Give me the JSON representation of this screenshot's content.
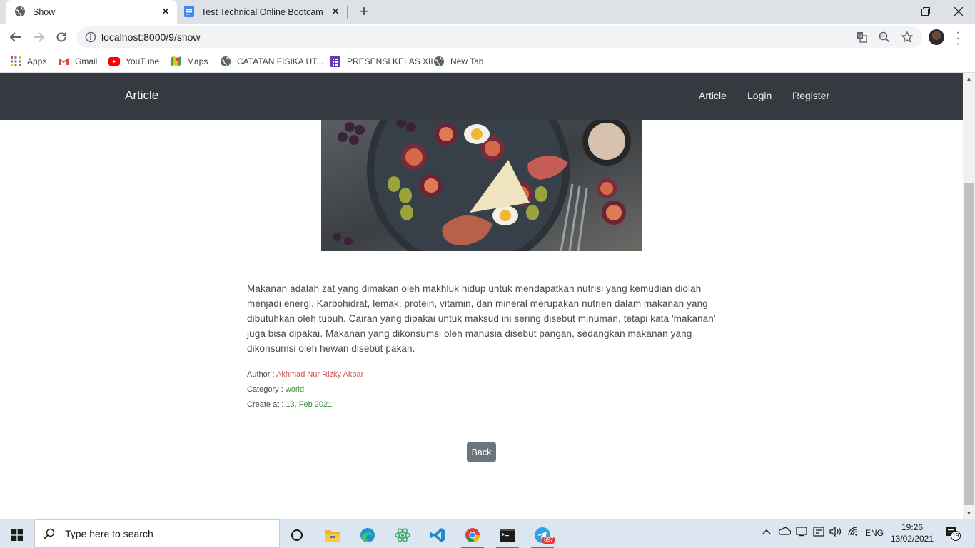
{
  "browser": {
    "tabs": [
      {
        "title": "Show",
        "active": true
      },
      {
        "title": "Test Technical Online Bootcamp D",
        "active": false
      }
    ],
    "url": "localhost:8000/9/show",
    "bookmarks": [
      "Apps",
      "Gmail",
      "YouTube",
      "Maps",
      "CATATAN FISIKA UT...",
      "PRESENSI KELAS XII",
      "New Tab"
    ]
  },
  "site": {
    "brand": "Article",
    "nav": [
      "Article",
      "Login",
      "Register"
    ]
  },
  "article": {
    "body": "Makanan adalah zat yang dimakan oleh makhluk hidup untuk mendapatkan nutrisi yang kemudian diolah menjadi energi. Karbohidrat, lemak, protein, vitamin, dan mineral merupakan nutrien dalam makanan yang dibutuhkan oleh tubuh. Cairan yang dipakai untuk maksud ini sering disebut minuman, tetapi kata 'makanan' juga bisa dipakai. Makanan yang dikonsumsi oleh manusia disebut pangan, sedangkan makanan yang dikonsumsi oleh hewan disebut pakan.",
    "author_label": "Author :",
    "author": "Akhmad Nur Rizky Akbar",
    "category_label": "Category :",
    "category": "world",
    "created_label": "Create at :",
    "created": "13, Feb 2021",
    "back_label": "Back"
  },
  "taskbar": {
    "search_placeholder": "Type here to search",
    "telegram_badge": "697",
    "language": "ENG",
    "time": "19:26",
    "date": "13/02/2021",
    "notification_count": "19"
  },
  "colors": {
    "navbar": "#343a40",
    "author": "#c65454",
    "category": "#3f8f3f",
    "back_button": "#6c757d"
  }
}
